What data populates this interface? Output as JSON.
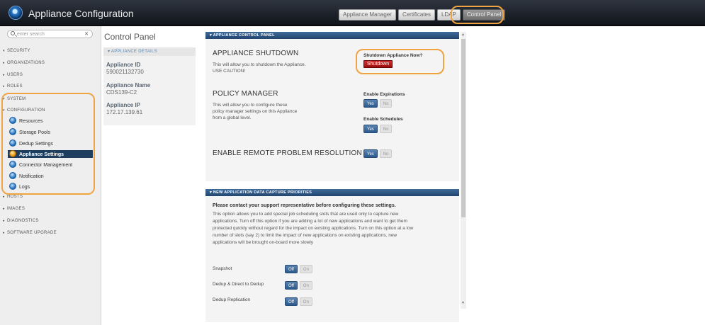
{
  "app": {
    "title": "Appliance Configuration"
  },
  "topnav": [
    "Appliance Manager",
    "Certificates",
    "LDAP",
    "Control Panel"
  ],
  "search": {
    "placeholder": "enter search",
    "clear": "✕"
  },
  "sidebar": {
    "security": "SECURITY",
    "organizations": "ORGANIZATIONS",
    "users": "USERS",
    "roles": "ROLES",
    "system": "SYSTEM",
    "configuration": "CONFIGURATION",
    "config_items": [
      "Resources",
      "Storage Pools",
      "Dedup Settings",
      "Appliance Settings",
      "Connector Management",
      "Notification",
      "Logs"
    ],
    "hosts": "HOSTS",
    "images": "IMAGES",
    "diagnostics": "DIAGNOSTICS",
    "software_upgrade": "SOFTWARE UPGRADE",
    "arrow_collapsed": "▸",
    "arrow_expanded": "▾"
  },
  "page_title": "Control Panel",
  "details": {
    "header": "APPLIANCE DETAILS",
    "appliance_id_label": "Appliance ID",
    "appliance_id": "590021132730",
    "appliance_name_label": "Appliance Name",
    "appliance_name": "CDS139-C2",
    "appliance_ip_label": "Appliance IP",
    "appliance_ip": "172.17.139.61"
  },
  "panel1": {
    "header": "APPLIANCE CONTROL PANEL",
    "shutdown": {
      "title": "APPLIANCE SHUTDOWN",
      "desc1": "This will allow you to shutdown the Appliance.",
      "desc2": "USE CAUTION!",
      "prompt": "Shutdown Appliance Now?",
      "button": "Shutdown"
    },
    "policy": {
      "title": "POLICY MANAGER",
      "desc1": "This will allow you to configure these",
      "desc2": "policy manager settings on this Appliance",
      "desc3": "from a global level.",
      "exp_label": "Enable Expirations",
      "sched_label": "Enable Schedules"
    },
    "remote": {
      "title": "ENABLE REMOTE PROBLEM RESOLUTION"
    },
    "yes": "Yes",
    "no": "No"
  },
  "panel2": {
    "header": "NEW APPLICATION DATA CAPTURE PRIORITIES",
    "warning": "Please contact your support representative before configuring these settings.",
    "lines": [
      "This option allows you to add special job scheduling slots that are used only to capture new",
      "applications. Turn off this option if you are adding a lot of new applications and want to get them",
      "protected quickly without regard for the impact on existing applications. Turn on this option at a low",
      "number of slots (say 2) to limit the impact of new applications on existing applications, new",
      "applications will be brought on-board more slowly"
    ],
    "settings": [
      "Snapshot",
      "Dedup & Direct to Dedup",
      "Dedup Replication"
    ],
    "off": "Off",
    "on": "On"
  },
  "scroll": {
    "up": "▲",
    "down": "▼"
  },
  "colors": {
    "accent": "#2b5a8c",
    "highlight": "#f0a341",
    "danger": "#b01414"
  }
}
